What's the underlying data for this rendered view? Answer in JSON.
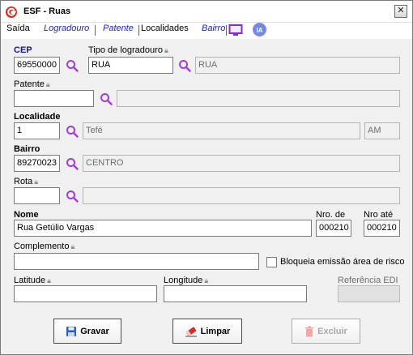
{
  "window": {
    "title": "ESF - Ruas",
    "close_glyph": "✕"
  },
  "menu": {
    "items": [
      {
        "label": "Saída"
      },
      {
        "label": "Logradouro"
      },
      {
        "label": "Patente"
      },
      {
        "label": "Localidades"
      },
      {
        "label": "Bairro"
      }
    ],
    "ia_label": "IA"
  },
  "form": {
    "cep": {
      "label": "CEP",
      "value": "69550000"
    },
    "tipo_logradouro": {
      "label": "Tipo de logradouro",
      "code": "RUA",
      "description": "RUA"
    },
    "patente": {
      "label": "Patente",
      "code": "",
      "description": ""
    },
    "localidade": {
      "label": "Localidade",
      "code": "1",
      "description": "Tefé",
      "uf": "AM"
    },
    "bairro": {
      "label": "Bairro",
      "code": "89270023",
      "description": "CENTRO"
    },
    "rota": {
      "label": "Rota",
      "code": "",
      "description": ""
    },
    "nome": {
      "label": "Nome",
      "value": "Rua Getúlio Vargas"
    },
    "nro_de": {
      "label": "Nro. de",
      "value": "000210"
    },
    "nro_ate": {
      "label": "Nro até",
      "value": "000210"
    },
    "complemento": {
      "label": "Complemento",
      "value": ""
    },
    "bloqueia": {
      "label": "Bloqueia emissão área de risco",
      "checked": false
    },
    "latitude": {
      "label": "Latitude",
      "value": ""
    },
    "longitude": {
      "label": "Longitude",
      "value": ""
    },
    "referencia_edi": {
      "label": "Referência EDI",
      "value": ""
    }
  },
  "buttons": {
    "gravar": "Gravar",
    "limpar": "Limpar",
    "excluir": "Excluir"
  },
  "icons": {
    "lock": "lock-icon",
    "search": "magnifier-icon",
    "monitor": "monitor-icon"
  },
  "colors": {
    "required_label": "#1a1a8c",
    "menu_link": "#2020c0",
    "search_icon": "#a040d0",
    "ia_badge": "#6a8de0"
  }
}
